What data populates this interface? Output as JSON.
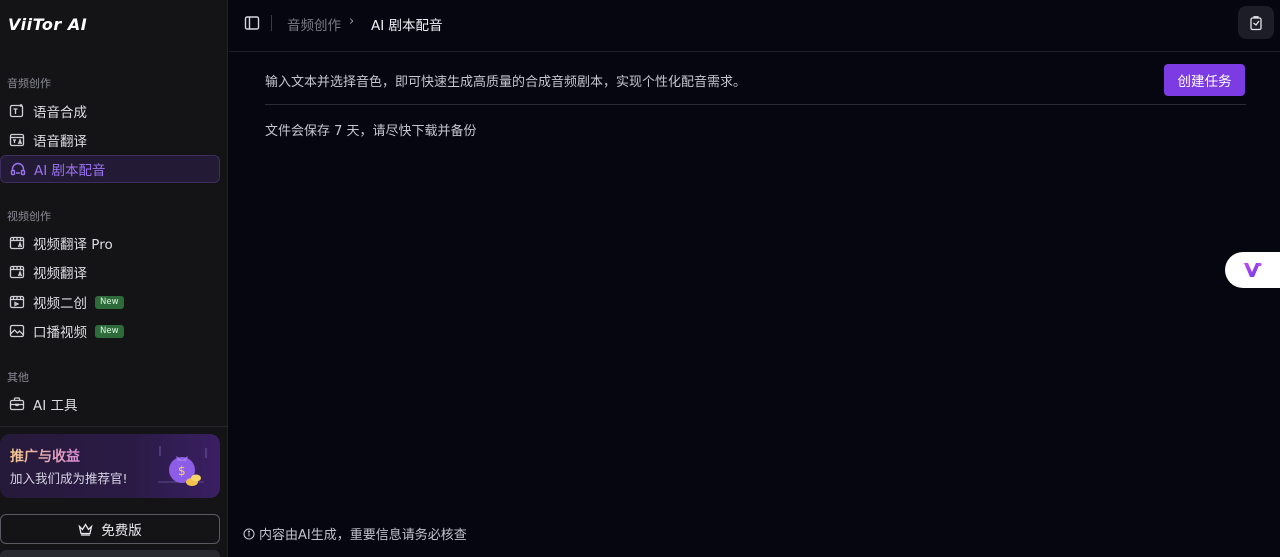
{
  "app": {
    "logo": "ViiTor AI"
  },
  "sidebar": {
    "sections": [
      {
        "title": "音频创作"
      },
      {
        "title": "视频创作"
      },
      {
        "title": "其他"
      }
    ],
    "items": [
      {
        "label": "语音合成",
        "icon": "text-audio-icon"
      },
      {
        "label": "语音翻译",
        "icon": "translate-icon"
      },
      {
        "label": "AI 剧本配音",
        "icon": "headset-icon",
        "active": true
      },
      {
        "label": "视频翻译 Pro",
        "icon": "video-translate-icon"
      },
      {
        "label": "视频翻译",
        "icon": "video-translate-icon"
      },
      {
        "label": "视频二创",
        "icon": "video-edit-icon",
        "badge": "New"
      },
      {
        "label": "口播视频",
        "icon": "image-icon",
        "badge": "New"
      },
      {
        "label": "AI 工具",
        "icon": "toolbox-icon"
      }
    ],
    "promo": {
      "title": "推广与收益",
      "subtitle": "加入我们成为推荐官!"
    },
    "plan_button": "免费版"
  },
  "header": {
    "breadcrumb": [
      "音频创作",
      "AI 剧本配音"
    ]
  },
  "main": {
    "description": "输入文本并选择音色，即可快速生成高质量的合成音频剧本，实现个性化配音需求。",
    "create_button": "创建任务",
    "retention_note": "文件会保存 7 天，请尽快下载并备份"
  },
  "footer": {
    "notice": "内容由AI生成，重要信息请务必核查"
  },
  "colors": {
    "accent": "#7c3be3",
    "active_text": "#9b73f2",
    "background": "#05060f",
    "sidebar": "#141416"
  }
}
